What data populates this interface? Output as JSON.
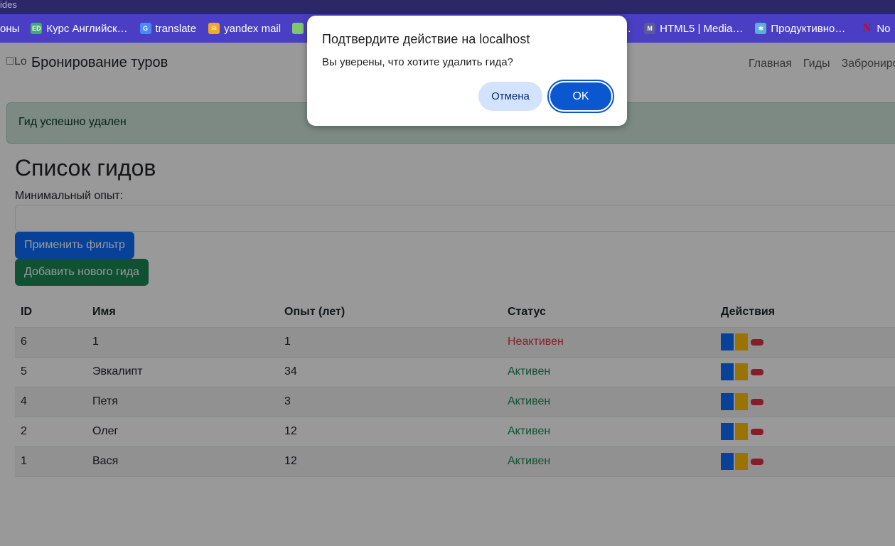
{
  "browser": {
    "title_fragment": "ides",
    "bookmarks": [
      {
        "label": "оны",
        "icon": "none",
        "color": ""
      },
      {
        "label": "Курс Английск…",
        "icon": "ed-icon",
        "color": "#3ab26f"
      },
      {
        "label": "translate",
        "icon": "translate-icon",
        "color": "#4a8af4"
      },
      {
        "label": "yandex mail",
        "icon": "mail-icon",
        "color": "#f5a623"
      },
      {
        "label": "",
        "icon": "green-bookmark-icon",
        "color": "#7ec86b"
      },
      {
        "label": "…",
        "icon": "none",
        "color": ""
      },
      {
        "label": "HTML5 | Media…",
        "icon": "m-icon",
        "color": "#5a5a9a"
      },
      {
        "label": "Продуктивно…",
        "icon": "gear-bookmark-icon",
        "color": "#5ab0d8"
      },
      {
        "label": "No",
        "icon": "n-icon",
        "color": "#d0021b"
      }
    ]
  },
  "navbar": {
    "logo_alt": "Lo",
    "brand": "Бронирование туров",
    "links": [
      "Главная",
      "Гиды",
      "Забронировать"
    ]
  },
  "alert": {
    "text": "Гид успешно удален"
  },
  "page_title": "Список гидов",
  "filter": {
    "label": "Минимальный опыт:",
    "value": "",
    "apply_label": "Применить фильтр",
    "add_label": "Добавить нового гида"
  },
  "table": {
    "headers": [
      "ID",
      "Имя",
      "Опыт (лет)",
      "Статус",
      "Действия"
    ],
    "rows": [
      {
        "id": "6",
        "name": "1",
        "experience": "1",
        "status": "Неактивен",
        "active": false
      },
      {
        "id": "5",
        "name": "Эвкалипт",
        "experience": "34",
        "status": "Активен",
        "active": true
      },
      {
        "id": "4",
        "name": "Петя",
        "experience": "3",
        "status": "Активен",
        "active": true
      },
      {
        "id": "2",
        "name": "Олег",
        "experience": "12",
        "status": "Активен",
        "active": true
      },
      {
        "id": "1",
        "name": "Вася",
        "experience": "12",
        "status": "Активен",
        "active": true
      }
    ]
  },
  "dialog": {
    "title": "Подтвердите действие на localhost",
    "message": "Вы уверены, что хотите удалить гида?",
    "cancel_label": "Отмена",
    "ok_label": "OK"
  },
  "colors": {
    "primary": "#0d6efd",
    "success": "#198754",
    "danger": "#dc3545",
    "warning": "#ffc107",
    "bookmarks_bar": "#4a3fc4"
  }
}
